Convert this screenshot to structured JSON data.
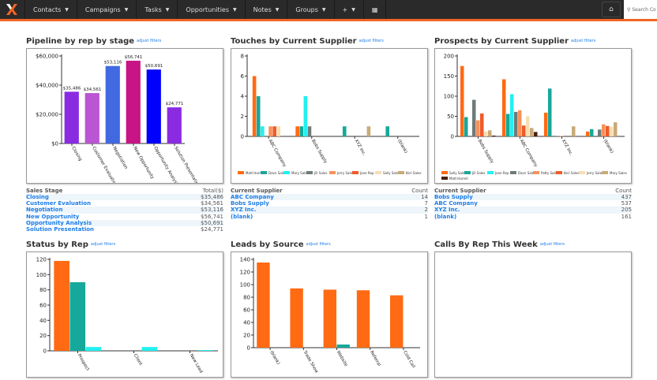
{
  "nav": {
    "items": [
      "Contacts",
      "Campaigns",
      "Tasks",
      "Opportunities",
      "Notes",
      "Groups",
      "+"
    ],
    "search_placeholder": "Search Co"
  },
  "panels": {
    "pipeline": {
      "title": "Pipeline by rep by stage",
      "adjust": "adjust filters",
      "table": {
        "headers": [
          "Sales Stage",
          "Total($)"
        ],
        "rows": [
          [
            "Closing",
            "$35,486"
          ],
          [
            "Customer Evaluation",
            "$34,561"
          ],
          [
            "Negotiation",
            "$53,116"
          ],
          [
            "New Opportunity",
            "$56,741"
          ],
          [
            "Opportunity Analysis",
            "$50,691"
          ],
          [
            "Solution Presentation",
            "$24,771"
          ]
        ]
      }
    },
    "touches": {
      "title": "Touches by Current Supplier",
      "adjust": "adjust filters",
      "table": {
        "headers": [
          "Current Supplier",
          "Count"
        ],
        "rows": [
          [
            "ABC Company",
            "14"
          ],
          [
            "Bobs Supply",
            "7"
          ],
          [
            "XYZ Inc.",
            "2"
          ],
          [
            "(blank)",
            "1"
          ]
        ]
      }
    },
    "prospects": {
      "title": "Prospects by Current Supplier",
      "adjust": "adjust filters",
      "table": {
        "headers": [
          "Current Supplier",
          "Count"
        ],
        "rows": [
          [
            "Bobs Supply",
            "437"
          ],
          [
            "ABC Company",
            "537"
          ],
          [
            "XYZ Inc.",
            "205"
          ],
          [
            "(blank)",
            "161"
          ]
        ]
      }
    },
    "status": {
      "title": "Status by Rep",
      "adjust": "adjust filters"
    },
    "leads": {
      "title": "Leads by Source",
      "adjust": "adjust filters"
    },
    "calls": {
      "title": "Calls By Rep This Week",
      "adjust": "adjust filters"
    }
  },
  "chart_data": [
    {
      "id": "pipeline",
      "type": "bar",
      "categories": [
        "Closing",
        "Customer Evaluation",
        "Negotiation",
        "New Opportunity",
        "Opportunity Analysis",
        "Solution Presentation"
      ],
      "values": [
        35486,
        34561,
        53116,
        56741,
        50691,
        24771
      ],
      "labels": [
        "$35,486",
        "$34,561",
        "$53,116",
        "$56,741",
        "$50,691",
        "$24,771"
      ],
      "colors": [
        "#8a2be2",
        "#ba55d3",
        "#4169e1",
        "#c71585",
        "#0000ff",
        "#8a2be2"
      ],
      "ylim": [
        0,
        60000
      ],
      "yticks": [
        0,
        20000,
        40000,
        60000
      ],
      "yticklabels": [
        "$0",
        "$20,000",
        "$40,000",
        "$60,000"
      ]
    },
    {
      "id": "touches",
      "type": "bar",
      "categories": [
        "ABC Company",
        "Bobs Supply",
        "XYZ Inc.",
        "(blank)"
      ],
      "ylim": [
        0,
        8
      ],
      "yticks": [
        0,
        2,
        4,
        6,
        8
      ],
      "yticklabels": [
        "0",
        "2",
        "4",
        "6",
        "8"
      ],
      "series": [
        {
          "name": "Matt Harrell",
          "color": "#ff6a13",
          "values": [
            6,
            1,
            0,
            0
          ]
        },
        {
          "name": "Davn Sales",
          "color": "#16a89a",
          "values": [
            4,
            1,
            1,
            1
          ]
        },
        {
          "name": "Mary Sales",
          "color": "#22f0f0",
          "values": [
            1,
            4,
            0,
            0
          ]
        },
        {
          "name": "Jill Sales",
          "color": "#6e7b7b",
          "values": [
            0,
            1,
            0,
            0
          ]
        },
        {
          "name": "Jerry Sales",
          "color": "#f7925a",
          "values": [
            1,
            0,
            0,
            0
          ]
        },
        {
          "name": "Jane Rep",
          "color": "#f05a28",
          "values": [
            1,
            0,
            0,
            0
          ]
        },
        {
          "name": "Sally Sales",
          "color": "#f5deb3",
          "values": [
            1,
            0,
            0,
            0
          ]
        },
        {
          "name": "Keri Sales",
          "color": "#c8aa78",
          "values": [
            0,
            0,
            1,
            0
          ]
        }
      ]
    },
    {
      "id": "prospects",
      "type": "bar",
      "categories": [
        "Bobs Supply",
        "ABC Company",
        "XYZ Inc.",
        "(blank)"
      ],
      "ylim": [
        0,
        200
      ],
      "yticks": [
        0,
        50,
        100,
        150,
        200
      ],
      "yticklabels": [
        "0",
        "50",
        "100",
        "150",
        "200"
      ],
      "series": [
        {
          "name": "Sally Sales",
          "color": "#ff6a13",
          "values": [
            175,
            142,
            59,
            12
          ]
        },
        {
          "name": "Jill Sales",
          "color": "#16a89a",
          "values": [
            48,
            56,
            119,
            18
          ]
        },
        {
          "name": "Jane Rep",
          "color": "#22f0f0",
          "values": [
            0,
            105,
            0,
            0
          ]
        },
        {
          "name": "Davn Sales",
          "color": "#6e7b7b",
          "values": [
            91,
            61,
            1,
            17
          ]
        },
        {
          "name": "Patty Sales",
          "color": "#f7925a",
          "values": [
            40,
            65,
            1,
            30
          ]
        },
        {
          "name": "Keri Sales",
          "color": "#f05a28",
          "values": [
            57,
            27,
            0,
            26
          ]
        },
        {
          "name": "Jerry Sales",
          "color": "#f5deb3",
          "values": [
            12,
            50,
            0,
            24
          ]
        },
        {
          "name": "Mary Sales",
          "color": "#c8aa78",
          "values": [
            15,
            21,
            25,
            35
          ]
        },
        {
          "name": "Matt Harrell",
          "color": "#4a2010",
          "values": [
            2,
            11,
            0,
            0
          ]
        }
      ]
    },
    {
      "id": "status",
      "type": "bar",
      "categories": [
        "Prospect",
        "Client",
        "New Lead"
      ],
      "ylim": [
        0,
        120
      ],
      "yticks": [
        0,
        20,
        40,
        60,
        80,
        100,
        120
      ],
      "yticklabels": [
        "0",
        "20",
        "40",
        "60",
        "80",
        "100",
        "120"
      ],
      "series": [
        {
          "color": "#ff6a13",
          "values": [
            118,
            0,
            0
          ]
        },
        {
          "color": "#16a89a",
          "values": [
            90,
            0,
            0
          ]
        },
        {
          "color": "#22f0f0",
          "values": [
            5,
            5,
            1
          ]
        }
      ]
    },
    {
      "id": "leads",
      "type": "bar",
      "categories": [
        "(blank)",
        "Trade Show",
        "Website",
        "Referral",
        "Cold Call"
      ],
      "ylim": [
        0,
        140
      ],
      "yticks": [
        0,
        20,
        40,
        60,
        80,
        100,
        120,
        140
      ],
      "yticklabels": [
        "0",
        "20",
        "40",
        "60",
        "80",
        "100",
        "120",
        "140"
      ],
      "series": [
        {
          "color": "#ff6a13",
          "values": [
            135,
            94,
            92,
            91,
            83
          ]
        },
        {
          "color": "#16a89a",
          "values": [
            0,
            0,
            5,
            0,
            0
          ]
        }
      ]
    }
  ]
}
